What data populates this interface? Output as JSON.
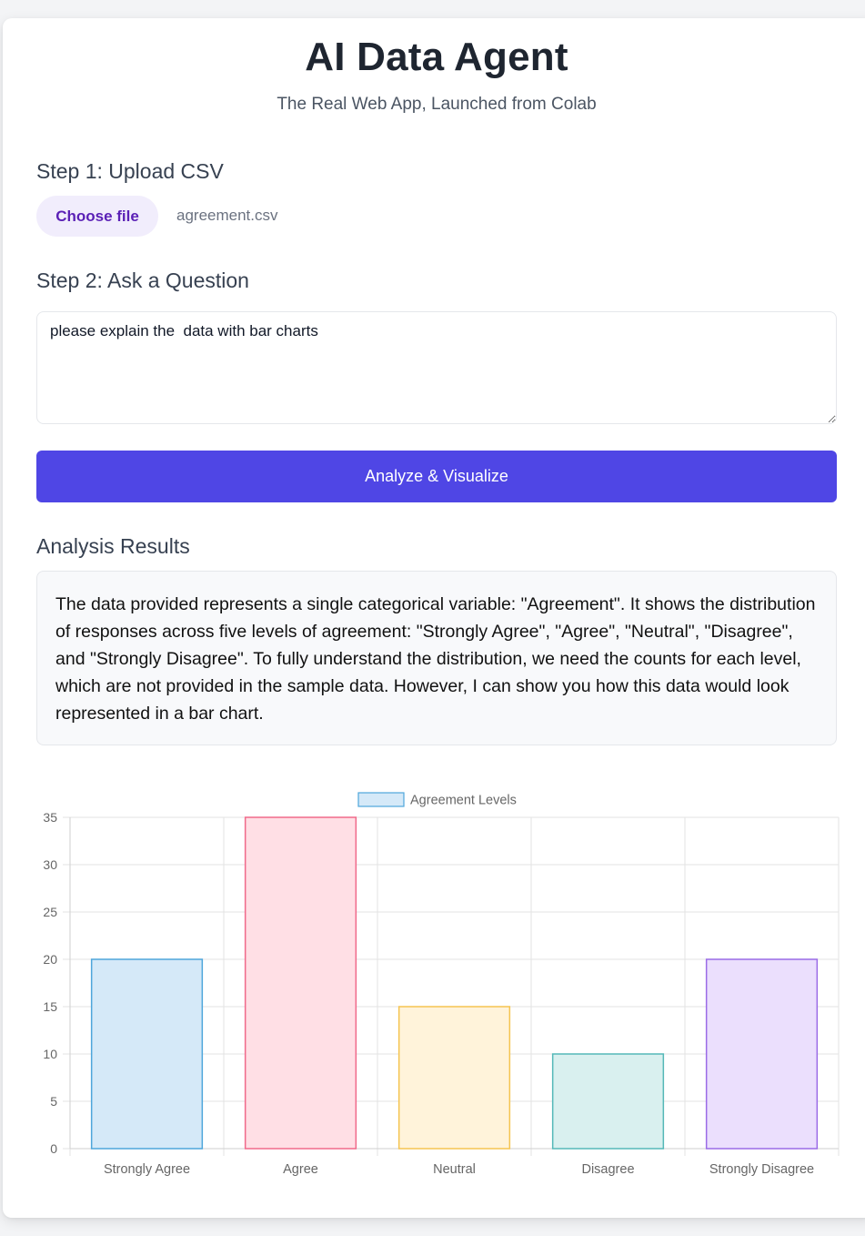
{
  "header": {
    "title": "AI Data Agent",
    "subtitle": "The Real Web App, Launched from Colab"
  },
  "step1": {
    "label": "Step 1: Upload CSV",
    "choose_file_label": "Choose file",
    "file_name": "agreement.csv"
  },
  "step2": {
    "label": "Step 2: Ask a Question",
    "question_value": "please explain the  data with bar charts"
  },
  "analyze_button_label": "Analyze & Visualize",
  "results": {
    "heading": "Analysis Results",
    "text": "The data provided represents a single categorical variable: \"Agreement\". It shows the distribution of responses across five levels of agreement: \"Strongly Agree\", \"Agree\", \"Neutral\", \"Disagree\", and \"Strongly Disagree\". To fully understand the distribution, we need the counts for each level, which are not provided in the sample data. However, I can show you how this data would look represented in a bar chart."
  },
  "colors": {
    "accent": "#4f46e5",
    "file_button_bg": "#f1edfc",
    "file_button_text": "#5b21b6"
  },
  "chart_data": {
    "type": "bar",
    "categories": [
      "Strongly Agree",
      "Agree",
      "Neutral",
      "Disagree",
      "Strongly Disagree"
    ],
    "series": [
      {
        "name": "Agreement Levels",
        "values": [
          20,
          35,
          15,
          10,
          20
        ]
      }
    ],
    "ylim": [
      0,
      35
    ],
    "yticks": [
      0,
      5,
      10,
      15,
      20,
      25,
      30,
      35
    ],
    "grid": true,
    "legend": "top-center",
    "bar_fills": [
      "#d5e9f8",
      "#ffdfe5",
      "#fff3da",
      "#d9f0ef",
      "#ebdffd"
    ],
    "bar_strokes": [
      "#4ea6db",
      "#f06a8a",
      "#f5c451",
      "#55b8b8",
      "#9a6be6"
    ],
    "legend_fill": "#d5e9f8",
    "legend_stroke": "#4ea6db"
  }
}
